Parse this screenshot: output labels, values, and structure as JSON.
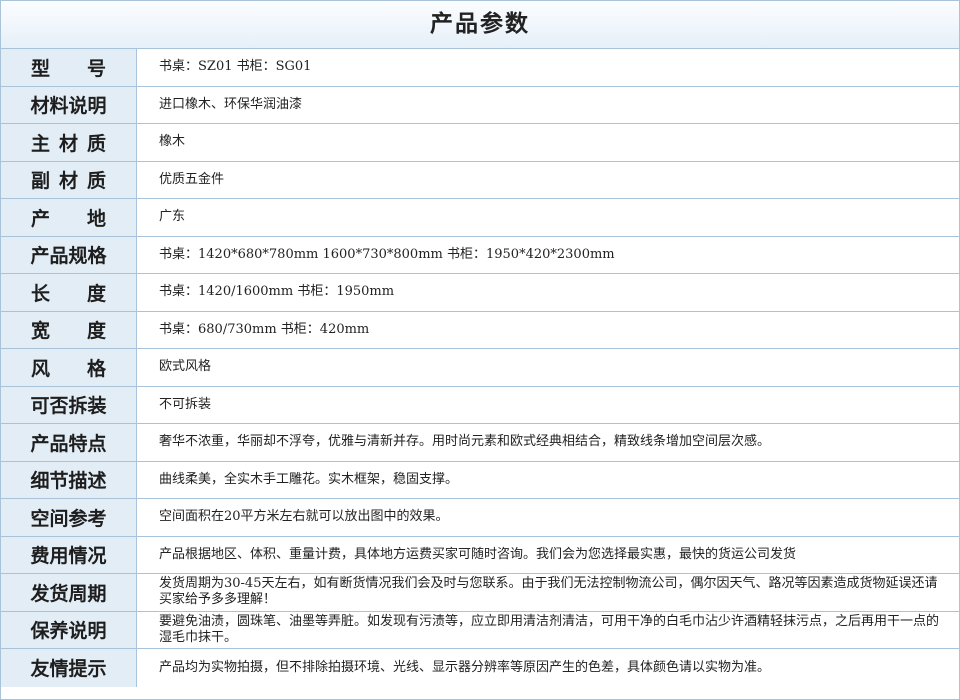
{
  "title": "产品参数",
  "rows": [
    {
      "label": "型号",
      "spread": true,
      "value": "书桌：SZ01  书柜：SG01"
    },
    {
      "label": "材料说明",
      "spread": false,
      "value": "进口橡木、环保华润油漆"
    },
    {
      "label": "主材质",
      "spread": true,
      "value": "橡木"
    },
    {
      "label": "副材质",
      "spread": true,
      "value": "优质五金件"
    },
    {
      "label": "产地",
      "spread": true,
      "value": "广东"
    },
    {
      "label": "产品规格",
      "spread": false,
      "value": "书桌：1420*680*780mm  1600*730*800mm  书柜：1950*420*2300mm"
    },
    {
      "label": "长度",
      "spread": true,
      "value": "书桌：1420/1600mm  书柜：1950mm"
    },
    {
      "label": "宽度",
      "spread": true,
      "value": "书桌：680/730mm  书柜：420mm"
    },
    {
      "label": "风格",
      "spread": true,
      "value": "欧式风格"
    },
    {
      "label": "可否拆装",
      "spread": false,
      "value": "不可拆装"
    },
    {
      "label": "产品特点",
      "spread": false,
      "value": "奢华不浓重，华丽却不浮夸，优雅与清新并存。用时尚元素和欧式经典相结合，精致线条增加空间层次感。"
    },
    {
      "label": "细节描述",
      "spread": false,
      "value": "曲线柔美，全实木手工雕花。实木框架，稳固支撑。"
    },
    {
      "label": "空间参考",
      "spread": false,
      "value": "空间面积在20平方米左右就可以放出图中的效果。"
    },
    {
      "label": "费用情况",
      "spread": false,
      "value": "产品根据地区、体积、重量计费，具体地方运费买家可随时咨询。我们会为您选择最实惠，最快的货运公司发货"
    },
    {
      "label": "发货周期",
      "spread": false,
      "value": "发货周期为30-45天左右，如有断货情况我们会及时与您联系。由于我们无法控制物流公司，偶尔因天气、路况等因素造成货物延误还请买家给予多多理解！"
    },
    {
      "label": "保养说明",
      "spread": false,
      "value": "要避免油渍，圆珠笔、油墨等弄脏。如发现有污渍等，应立即用清洁剂清洁，可用干净的白毛巾沾少许酒精轻抹污点，之后再用干一点的湿毛巾抹干。"
    },
    {
      "label": "友情提示",
      "spread": false,
      "value": "产品均为实物拍摄，但不排除拍摄环境、光线、显示器分辨率等原因产生的色差，具体颜色请以实物为准。"
    }
  ]
}
